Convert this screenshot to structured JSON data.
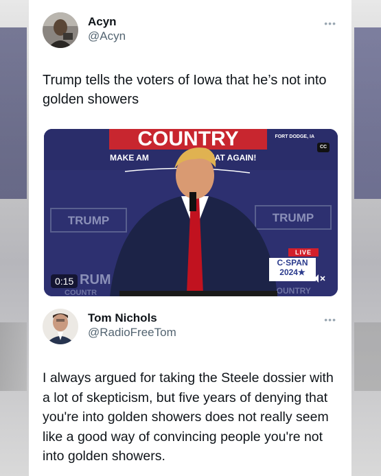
{
  "tweet1": {
    "display_name": "Acyn",
    "handle": "@Acyn",
    "text": "Trump tells the voters of Iowa that he’s not into golden showers",
    "video": {
      "duration": "0:15",
      "location": "FORT DODGE, IA",
      "live_label": "LIVE",
      "network_line1": "C·SPAN",
      "network_line2": "2024★",
      "cc_label": "CC"
    }
  },
  "tweet2": {
    "display_name": "Tom Nichols",
    "handle": "@RadioFreeTom",
    "text": "I always argued for taking the Steele dossier with a lot of skepticism, but five years of denying that you're into golden showers does not really seem like a good way of convincing people you're not into golden showers."
  },
  "icons": {
    "more": "more-options-icon",
    "mute": "volume-muted-icon",
    "captions": "closed-captions-icon"
  },
  "colors": {
    "text_primary": "#0f1419",
    "text_secondary": "#536471",
    "video_backdrop": "#2b2e6e",
    "live_red": "#d31f2b"
  }
}
